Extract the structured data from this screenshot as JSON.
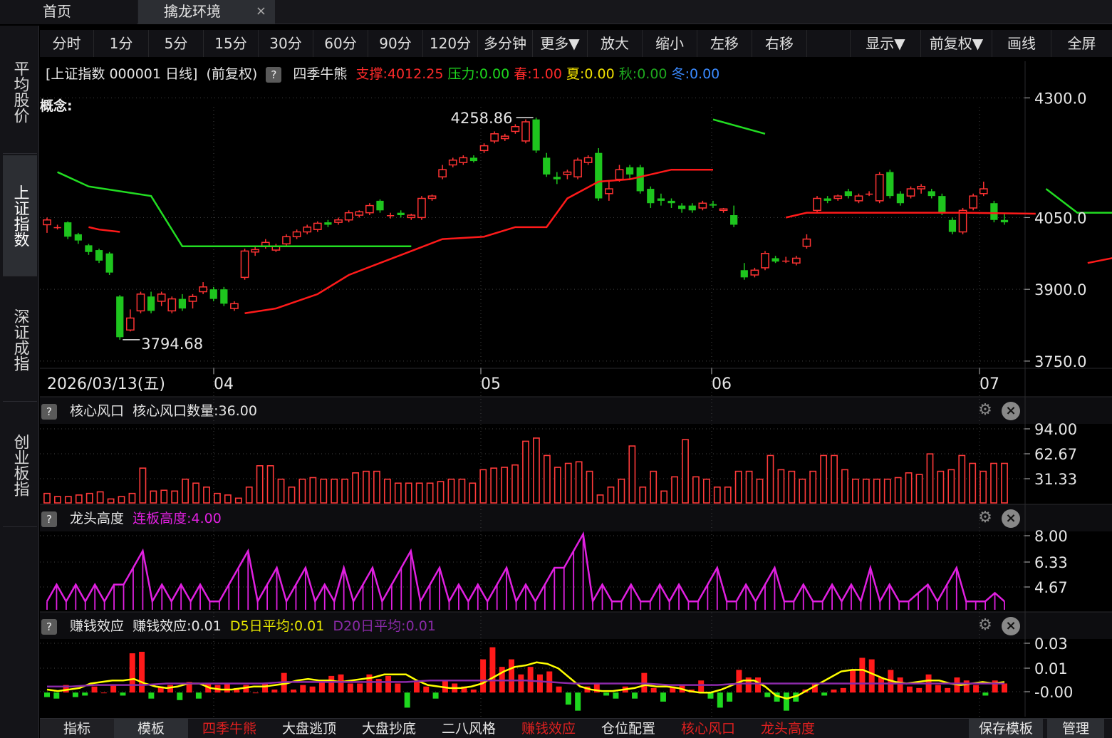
{
  "tabs": [
    {
      "label": "首页"
    },
    {
      "label": "擒龙环境",
      "close": "×"
    }
  ],
  "sidebar": [
    {
      "label": "平均股价"
    },
    {
      "label": "上证指数"
    },
    {
      "label": "深证成指"
    },
    {
      "label": "创业板指"
    }
  ],
  "toolbar": [
    "分时",
    "1分",
    "5分",
    "15分",
    "30分",
    "60分",
    "90分",
    "120分",
    "多分钟",
    "更多▼",
    "放大",
    "缩小",
    "左移",
    "右移",
    "显示▼",
    "前复权▼",
    "画线",
    "全屏"
  ],
  "info": {
    "title": "[上证指数 000001 日线]",
    "fq": "(前复权)",
    "help": "?",
    "indicator": "四季牛熊",
    "support": "支撑:4012.25",
    "pressure": "压力:0.00",
    "spring": "春:1.00",
    "summer": "夏:0.00",
    "autumn": "秋:0.00",
    "winter": "冬:0.00",
    "concept": "概念:"
  },
  "colors": {
    "up": "#ff3333",
    "down": "#1ec51e",
    "flat": "#ffff00",
    "support": "#ff1a1a",
    "pressure": "#22dd22",
    "magenta": "#e020e0",
    "purple": "#8a2aa8"
  },
  "price_axis": {
    "ticks": [
      "4300.0",
      "4050.0",
      "3900.0",
      "3750.0"
    ]
  },
  "annotations": {
    "high": "4258.86",
    "low": "3794.68"
  },
  "date_axis": {
    "first": "2026/03/13(五)",
    "months": [
      "04",
      "05",
      "06",
      "07"
    ]
  },
  "chart_data": {
    "type": "candlestick",
    "ylim": [
      3735,
      4320
    ],
    "candles": [
      [
        4035,
        4045,
        4018,
        4050
      ],
      [
        4030,
        4030,
        4025,
        4035
      ],
      [
        4040,
        4010,
        4005,
        4042
      ],
      [
        4015,
        4002,
        3995,
        4018
      ],
      [
        3992,
        3978,
        3972,
        3995
      ],
      [
        3982,
        3960,
        3955,
        3985
      ],
      [
        3975,
        3935,
        3930,
        3978
      ],
      [
        3885,
        3800,
        3794.68,
        3888
      ],
      [
        3815,
        3840,
        3812,
        3858
      ],
      [
        3855,
        3890,
        3850,
        3895
      ],
      [
        3885,
        3855,
        3850,
        3895
      ],
      [
        3875,
        3890,
        3865,
        3895
      ],
      [
        3855,
        3880,
        3850,
        3885
      ],
      [
        3880,
        3860,
        3855,
        3890
      ],
      [
        3875,
        3885,
        3860,
        3890
      ],
      [
        3895,
        3905,
        3890,
        3915
      ],
      [
        3900,
        3880,
        3875,
        3905
      ],
      [
        3900,
        3870,
        3865,
        3905
      ],
      [
        3860,
        3870,
        3855,
        3875
      ],
      [
        3925,
        3980,
        3920,
        3985
      ],
      [
        3978,
        3983,
        3970,
        3988
      ],
      [
        3990,
        3998,
        3985,
        4005
      ],
      [
        3982,
        3990,
        3978,
        3995
      ],
      [
        3995,
        4010,
        3990,
        4015
      ],
      [
        4010,
        4020,
        4005,
        4025
      ],
      [
        4020,
        4030,
        4015,
        4035
      ],
      [
        4025,
        4038,
        4020,
        4042
      ],
      [
        4040,
        4035,
        4030,
        4045
      ],
      [
        4040,
        4045,
        4035,
        4050
      ],
      [
        4045,
        4060,
        4040,
        4065
      ],
      [
        4055,
        4062,
        4050,
        4065
      ],
      [
        4060,
        4075,
        4055,
        4080
      ],
      [
        4085,
        4065,
        4060,
        4088
      ],
      [
        4055,
        4055,
        4048,
        4060
      ],
      [
        4060,
        4055,
        4050,
        4065
      ],
      [
        4050,
        4055,
        4045,
        4058
      ],
      [
        4050,
        4090,
        4045,
        4095
      ],
      [
        4090,
        4095,
        4085,
        4098
      ],
      [
        4135,
        4150,
        4130,
        4160
      ],
      [
        4160,
        4170,
        4155,
        4175
      ],
      [
        4165,
        4175,
        4160,
        4180
      ],
      [
        4175,
        4168,
        4165,
        4180
      ],
      [
        4190,
        4200,
        4185,
        4205
      ],
      [
        4210,
        4225,
        4205,
        4230
      ],
      [
        4215,
        4220,
        4210,
        4225
      ],
      [
        4230,
        4240,
        4225,
        4245
      ],
      [
        4210,
        4250,
        4205,
        4255
      ],
      [
        4255,
        4190,
        4185,
        4258.86
      ],
      [
        4175,
        4140,
        4135,
        4185
      ],
      [
        4135,
        4130,
        4120,
        4145
      ],
      [
        4140,
        4145,
        4130,
        4150
      ],
      [
        4135,
        4170,
        4130,
        4175
      ],
      [
        4165,
        4175,
        4160,
        4180
      ],
      [
        4185,
        4090,
        4085,
        4195
      ],
      [
        4100,
        4110,
        4085,
        4125
      ],
      [
        4130,
        4150,
        4125,
        4160
      ],
      [
        4155,
        4140,
        4130,
        4160
      ],
      [
        4155,
        4105,
        4100,
        4160
      ],
      [
        4110,
        4080,
        4070,
        4115
      ],
      [
        4090,
        4085,
        4075,
        4100
      ],
      [
        4085,
        4080,
        4070,
        4090
      ],
      [
        4075,
        4068,
        4060,
        4080
      ],
      [
        4075,
        4065,
        4060,
        4080
      ],
      [
        4070,
        4080,
        4065,
        4085
      ],
      [
        4078,
        4075,
        4070,
        4085
      ],
      [
        4065,
        4068,
        4060,
        4070
      ],
      [
        4055,
        4035,
        4030,
        4075
      ],
      [
        3940,
        3925,
        3920,
        3955
      ],
      [
        3930,
        3940,
        3925,
        3945
      ],
      [
        3945,
        3975,
        3940,
        3980
      ],
      [
        3965,
        3958,
        3955,
        3970
      ],
      [
        3960,
        3960,
        3955,
        3968
      ],
      [
        3955,
        3965,
        3950,
        3970
      ],
      [
        3990,
        4005,
        3985,
        4015
      ],
      [
        4065,
        4090,
        4060,
        4095
      ],
      [
        4090,
        4085,
        4080,
        4095
      ],
      [
        4090,
        4095,
        4085,
        4098
      ],
      [
        4105,
        4095,
        4090,
        4110
      ],
      [
        4085,
        4095,
        4080,
        4100
      ],
      [
        4100,
        4100,
        4095,
        4105
      ],
      [
        4085,
        4140,
        4080,
        4145
      ],
      [
        4145,
        4095,
        4090,
        4150
      ],
      [
        4100,
        4080,
        4075,
        4105
      ],
      [
        4095,
        4110,
        4090,
        4115
      ],
      [
        4110,
        4115,
        4100,
        4120
      ],
      [
        4105,
        4095,
        4090,
        4110
      ],
      [
        4095,
        4060,
        4055,
        4100
      ],
      [
        4045,
        4020,
        4015,
        4050
      ],
      [
        4020,
        4065,
        4015,
        4070
      ],
      [
        4070,
        4095,
        4065,
        4100
      ],
      [
        4100,
        4110,
        4095,
        4125
      ],
      [
        4080,
        4045,
        4040,
        4085
      ],
      [
        4045,
        4040,
        4035,
        4060
      ]
    ],
    "support_segments": [
      [
        [
          4,
          4030
        ],
        [
          5,
          4025
        ],
        [
          7,
          4020
        ]
      ],
      [
        [
          19,
          3850
        ],
        [
          22,
          3860
        ],
        [
          24,
          3875
        ],
        [
          26,
          3890
        ],
        [
          29,
          3930
        ],
        [
          32,
          3955
        ],
        [
          35,
          3980
        ],
        [
          38,
          4005
        ],
        [
          42,
          4010
        ],
        [
          45,
          4030
        ],
        [
          48,
          4030
        ],
        [
          50,
          4090
        ],
        [
          53,
          4125
        ],
        [
          56,
          4130
        ],
        [
          60,
          4150
        ],
        [
          64,
          4150
        ]
      ],
      [
        [
          71,
          4050
        ],
        [
          73,
          4060
        ],
        [
          80,
          4060
        ],
        [
          88,
          4060
        ],
        [
          95,
          4058
        ]
      ],
      [
        [
          100,
          3955
        ],
        [
          103,
          3968
        ],
        [
          109,
          3978
        ],
        [
          112,
          3995
        ],
        [
          114,
          4015
        ],
        [
          121,
          4015
        ],
        [
          130,
          4012.25
        ]
      ]
    ],
    "pressure_segments": [
      [
        [
          1,
          4145
        ],
        [
          4,
          4115
        ],
        [
          10,
          4095
        ],
        [
          13,
          3990
        ],
        [
          20,
          3990
        ],
        [
          35,
          3990
        ]
      ],
      [
        [
          64,
          4255
        ],
        [
          69,
          4225
        ]
      ],
      [
        [
          96,
          4110
        ],
        [
          99,
          4060
        ],
        [
          105,
          4060
        ],
        [
          121,
          4060
        ]
      ]
    ],
    "panels": [
      {
        "id": "core",
        "title": "核心风口",
        "label": "核心风口数量:36.00",
        "ticks": [
          "94.00",
          "62.67",
          "31.33"
        ],
        "ylim": [
          0,
          100
        ],
        "type": "bar",
        "values": [
          12,
          8,
          8,
          10,
          12,
          14,
          5,
          8,
          12,
          44,
          15,
          16,
          15,
          30,
          25,
          20,
          12,
          10,
          6,
          20,
          47,
          47,
          30,
          20,
          30,
          32,
          30,
          30,
          30,
          38,
          40,
          40,
          30,
          25,
          25,
          25,
          25,
          27,
          30,
          30,
          25,
          42,
          44,
          45,
          48,
          78,
          82,
          60,
          45,
          50,
          52,
          40,
          10,
          20,
          30,
          72,
          20,
          40,
          15,
          33,
          80,
          33,
          30,
          20,
          20,
          40,
          40,
          30,
          60,
          42,
          40,
          30,
          40,
          60,
          60,
          42,
          30,
          30,
          30,
          30,
          32,
          38,
          36,
          62,
          40,
          42,
          60,
          50,
          40,
          50,
          50
        ]
      },
      {
        "id": "dragon",
        "title": "龙头高度",
        "label": "连板高度:4.00",
        "ticks": [
          "8.00",
          "6.33",
          "4.67"
        ],
        "ylim": [
          3.5,
          8.2
        ],
        "type": "line",
        "values": [
          4,
          5,
          4,
          5,
          4,
          5,
          4,
          5,
          5,
          6,
          7,
          4,
          5,
          4,
          5,
          4,
          5,
          4,
          4,
          5,
          6,
          7,
          4,
          5,
          6,
          4,
          5,
          6,
          4,
          5,
          4,
          6,
          4,
          5,
          6,
          4,
          5,
          6,
          7,
          4,
          5,
          6,
          4,
          5,
          4,
          5,
          4,
          5,
          6,
          4,
          5,
          4,
          5,
          6,
          6,
          7,
          8,
          4,
          5,
          4,
          4,
          5,
          4,
          4,
          5,
          4,
          5,
          4,
          4,
          5,
          6,
          4,
          4,
          5,
          4,
          5,
          6,
          4,
          4,
          5,
          4,
          4,
          5,
          4,
          5,
          4,
          6,
          4,
          5,
          4,
          4,
          4.5,
          5,
          4,
          5,
          6,
          4,
          4,
          4,
          4.5,
          4
        ]
      },
      {
        "id": "money",
        "title": "赚钱效应",
        "label": "赚钱效应:0.01",
        "d5": "D5日平均:0.01",
        "d20": "D20日平均:0.01",
        "ticks": [
          "0.03",
          "0.01",
          "-0.00"
        ],
        "ylim": [
          -0.015,
          0.035
        ],
        "type": "barline",
        "values": [
          -0.003,
          -0.004,
          0.005,
          -0.003,
          -0.002,
          0.004,
          0.0,
          0.005,
          -0.002,
          0.026,
          0.027,
          -0.004,
          0.004,
          0.005,
          -0.005,
          0.007,
          -0.004,
          0.006,
          0.005,
          0.006,
          0.003,
          0.005,
          0.0,
          0.006,
          0.002,
          0.013,
          0.002,
          0.005,
          0.004,
          0.008,
          0.011,
          0.012,
          0.006,
          0.006,
          0.012,
          0.009,
          0.011,
          0.006,
          -0.01,
          0.008,
          0.004,
          -0.004,
          0.008,
          0.006,
          0.004,
          0.002,
          0.022,
          0.03,
          0.017,
          0.022,
          0.012,
          0.017,
          0.012,
          0.014,
          0.004,
          -0.008,
          -0.012,
          0.004,
          0.006,
          -0.002,
          -0.004,
          0.004,
          -0.004,
          0.013,
          0.003,
          -0.006,
          0.004,
          0.005,
          0.002,
          0.008,
          -0.004,
          -0.01,
          -0.006,
          0.015,
          0.01,
          0.01,
          -0.003,
          -0.006,
          -0.012,
          -0.006,
          0.002,
          0.006,
          -0.002,
          0.002,
          0.003,
          0.015,
          0.023,
          0.022,
          0.01,
          0.015,
          0.01,
          0.004,
          0.003,
          0.012,
          0.005,
          0.003,
          0.01,
          0.008,
          0.005,
          -0.002,
          0.008,
          0.006
        ],
        "d5_values": [
          0.002,
          0.001,
          0.002,
          0.003,
          0.006,
          0.007,
          0.008,
          0.008,
          0.009,
          0.006,
          0.004,
          0.003,
          0.004,
          0.006,
          0.006,
          0.003,
          0.002,
          0.002,
          0.003,
          0.004,
          0.004,
          0.005,
          0.006,
          0.008,
          0.009,
          0.008,
          0.008,
          0.007,
          0.008,
          0.009,
          0.01,
          0.012,
          0.012,
          0.012,
          0.008,
          0.005,
          0.004,
          0.003,
          0.003,
          0.004,
          0.006,
          0.01,
          0.014,
          0.017,
          0.018,
          0.02,
          0.019,
          0.016,
          0.01,
          0.004,
          0.002,
          0.001,
          0.001,
          0.002,
          0.003,
          0.005,
          0.004,
          0.004,
          0.003,
          0.001,
          0.0,
          0.0,
          0.002,
          0.005,
          0.008,
          0.008,
          0.004,
          -0.002,
          -0.004,
          -0.002,
          0.002,
          0.006,
          0.01,
          0.014,
          0.015,
          0.015,
          0.012,
          0.009,
          0.007,
          0.006,
          0.007,
          0.008,
          0.008,
          0.006,
          0.005,
          0.006,
          0.007,
          0.006,
          0.007
        ],
        "d20_values": [
          0.004,
          0.004,
          0.005,
          0.005,
          0.005,
          0.006,
          0.006,
          0.006,
          0.006,
          0.006,
          0.007,
          0.007,
          0.007,
          0.007,
          0.007,
          0.007,
          0.008,
          0.008,
          0.008,
          0.008,
          0.008,
          0.007,
          0.006,
          0.006,
          0.006,
          0.006,
          0.005,
          0.005,
          0.005,
          0.006,
          0.006,
          0.006,
          0.006,
          0.006,
          0.006,
          0.006,
          0.006,
          0.006,
          0.006,
          0.006,
          0.006
        ]
      }
    ]
  },
  "bottom": {
    "items": [
      "指标",
      "模板",
      "四季牛熊",
      "大盘逃顶",
      "大盘抄底",
      "二八风格",
      "赚钱效应",
      "仓位配置",
      "核心风口",
      "龙头高度"
    ],
    "right": [
      "保存模板",
      "管理"
    ]
  }
}
